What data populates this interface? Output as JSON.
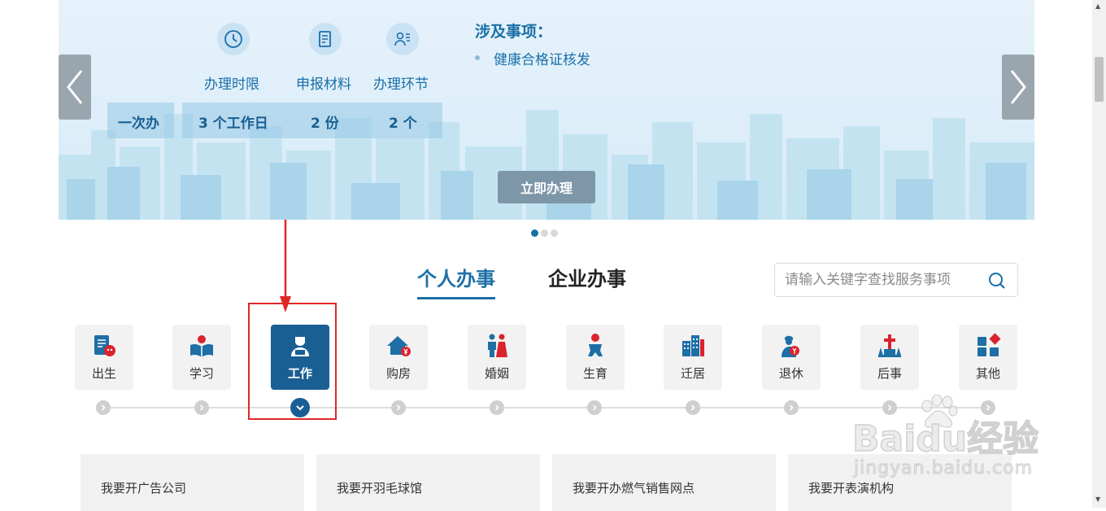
{
  "banner": {
    "stats": [
      {
        "icon": "clock-icon",
        "label": "办理时限",
        "value": "3 个工作日"
      },
      {
        "icon": "document-icon",
        "label": "申报材料",
        "value": "2 份"
      },
      {
        "icon": "steps-icon",
        "label": "办理环节",
        "value": "2 个"
      }
    ],
    "badge": "一次办",
    "involve_title": "涉及事项：",
    "involve_items": [
      "健康合格证核发"
    ],
    "apply_button": "立即办理",
    "slide_count": 3,
    "active_slide": 1
  },
  "tabs": [
    {
      "label": "个人办事",
      "active": true
    },
    {
      "label": "企业办事",
      "active": false
    }
  ],
  "search": {
    "placeholder": "请输入关键字查找服务事项",
    "icon": "search-icon"
  },
  "categories": [
    {
      "label": "出生",
      "icon": "birth-icon"
    },
    {
      "label": "学习",
      "icon": "study-icon"
    },
    {
      "label": "工作",
      "icon": "work-icon",
      "active": true
    },
    {
      "label": "购房",
      "icon": "house-icon"
    },
    {
      "label": "婚姻",
      "icon": "marriage-icon"
    },
    {
      "label": "生育",
      "icon": "baby-icon"
    },
    {
      "label": "迁居",
      "icon": "relocate-icon"
    },
    {
      "label": "退休",
      "icon": "retire-icon"
    },
    {
      "label": "后事",
      "icon": "funeral-icon"
    },
    {
      "label": "其他",
      "icon": "other-icon"
    }
  ],
  "services": [
    "我要开广告公司",
    "我要开羽毛球馆",
    "我要开办燃气销售网点",
    "我要开表演机构"
  ],
  "watermark": {
    "main": "Baidu经验",
    "sub": "jingyan.baidu.com"
  },
  "colors": {
    "primary": "#1a5f94",
    "accent_text": "#1a6fa8",
    "highlight": "#e02828"
  }
}
